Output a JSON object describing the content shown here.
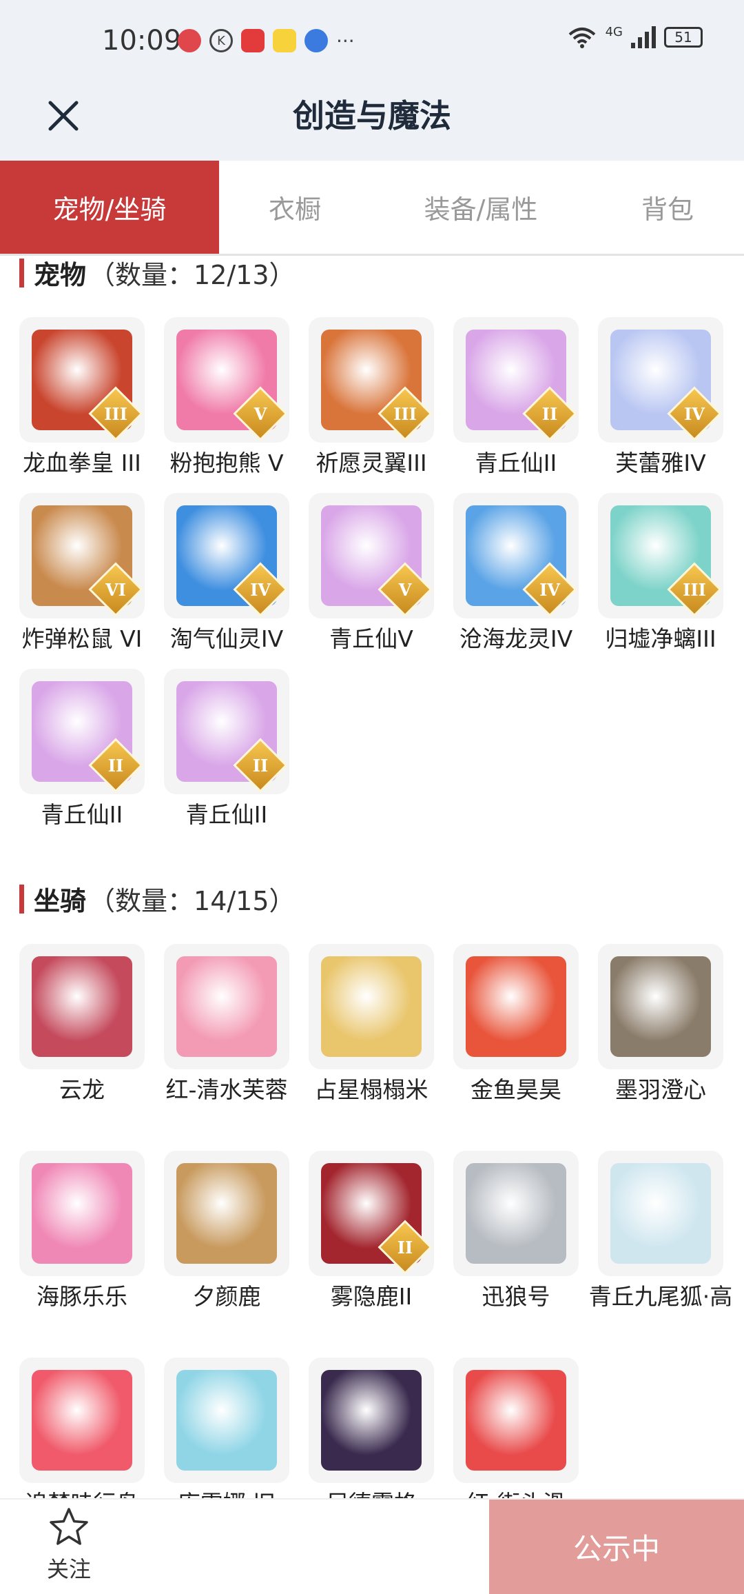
{
  "status_bar": {
    "time": "10:09",
    "network": "4G",
    "battery": "51"
  },
  "header": {
    "title": "创造与魔法",
    "close_icon": "close-icon"
  },
  "tabs": [
    {
      "label": "宠物/坐骑",
      "active": true
    },
    {
      "label": "衣橱",
      "active": false
    },
    {
      "label": "装备/属性",
      "active": false
    },
    {
      "label": "背包",
      "active": false
    }
  ],
  "pets": {
    "title": "宠物",
    "count": "（数量：12/13）",
    "items": [
      {
        "name": "龙血拳皇 III",
        "rank": "III",
        "color": "#c9452e"
      },
      {
        "name": "粉抱抱熊 V",
        "rank": "V",
        "color": "#f07aa8"
      },
      {
        "name": "祈愿灵翼III",
        "rank": "III",
        "color": "#d9743a"
      },
      {
        "name": "青丘仙II",
        "rank": "II",
        "color": "#d9a6e8"
      },
      {
        "name": "芙蕾雅IV",
        "rank": "IV",
        "color": "#b9c6f2"
      },
      {
        "name": "炸弹松鼠 VI",
        "rank": "VI",
        "color": "#c98a4e"
      },
      {
        "name": "淘气仙灵IV",
        "rank": "IV",
        "color": "#3f8fe0"
      },
      {
        "name": "青丘仙V",
        "rank": "V",
        "color": "#d9a6e8"
      },
      {
        "name": "沧海龙灵IV",
        "rank": "IV",
        "color": "#5aa3e6"
      },
      {
        "name": "归墟净螭III",
        "rank": "III",
        "color": "#7dd3c9"
      },
      {
        "name": "青丘仙II",
        "rank": "II",
        "color": "#d9a6e8"
      },
      {
        "name": "青丘仙II",
        "rank": "II",
        "color": "#d9a6e8"
      }
    ]
  },
  "mounts": {
    "title": "坐骑",
    "count": "（数量：14/15）",
    "items": [
      {
        "name": "云龙",
        "rank": "",
        "color": "#c44a5c"
      },
      {
        "name": "红-清水芙蓉",
        "rank": "",
        "color": "#f39ab4"
      },
      {
        "name": "占星榻榻米",
        "rank": "",
        "color": "#e9c56b"
      },
      {
        "name": "金鱼昊昊",
        "rank": "",
        "color": "#e8553b"
      },
      {
        "name": "墨羽澄心",
        "rank": "",
        "color": "#8a7c6a"
      },
      {
        "name": "海豚乐乐",
        "rank": "",
        "color": "#f088b6"
      },
      {
        "name": "夕颜鹿",
        "rank": "",
        "color": "#c89a5e"
      },
      {
        "name": "雾隐鹿II",
        "rank": "II",
        "color": "#a3262f"
      },
      {
        "name": "迅狼号",
        "rank": "",
        "color": "#b7bcc2"
      },
      {
        "name": "青丘九尾狐·高",
        "rank": "",
        "color": "#cfe6ef"
      },
      {
        "name": "追梦哇行鸟",
        "rank": "",
        "color": "#f05a6a"
      },
      {
        "name": "库雷娜·旧",
        "rank": "",
        "color": "#8fd5e6"
      },
      {
        "name": "尼德霍格",
        "rank": "",
        "color": "#3a2a4e"
      },
      {
        "name": "红-街头滑",
        "rank": "",
        "color": "#e94b4b"
      }
    ]
  },
  "bottom_bar": {
    "follow_label": "关注",
    "follow_icon": "star-icon",
    "status_button": "公示中"
  },
  "colors": {
    "accent": "#c8393a",
    "public_button": "#e29c99",
    "header_bg": "#eef2f6"
  }
}
